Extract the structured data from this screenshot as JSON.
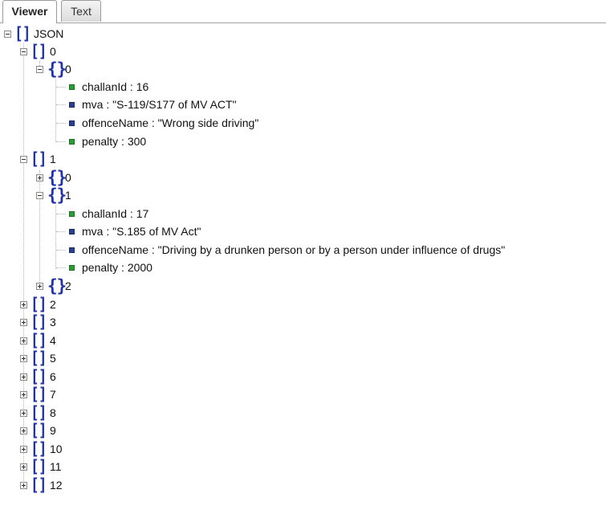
{
  "tabs": [
    {
      "label": "Viewer",
      "active": true
    },
    {
      "label": "Text",
      "active": false
    }
  ],
  "tree": {
    "root_label": "JSON",
    "n0": {
      "label": "0",
      "n0_0": {
        "label": "0",
        "props": [
          {
            "text": "challanId : 16",
            "kind": "number"
          },
          {
            "text": "mva : \"S-119/S177 of MV ACT\"",
            "kind": "string"
          },
          {
            "text": "offenceName : \"Wrong side driving\"",
            "kind": "string"
          },
          {
            "text": "penalty : 300",
            "kind": "number"
          }
        ]
      }
    },
    "n1": {
      "label": "1",
      "n1_0": {
        "label": "0"
      },
      "n1_1": {
        "label": "1",
        "props": [
          {
            "text": "challanId : 17",
            "kind": "number"
          },
          {
            "text": "mva : \"S.185 of MV Act\"",
            "kind": "string"
          },
          {
            "text": "offenceName : \"Driving by a drunken person or by a person under influence of drugs\"",
            "kind": "string"
          },
          {
            "text": "penalty : 2000",
            "kind": "number"
          }
        ]
      },
      "n1_2": {
        "label": "2"
      }
    },
    "collapsed": [
      "2",
      "3",
      "4",
      "5",
      "6",
      "7",
      "8",
      "9",
      "10",
      "11",
      "12"
    ]
  },
  "colors": {
    "bracket": "#2233aa",
    "number_leaf": "#2e9a3a",
    "string_leaf": "#2c3f8f"
  },
  "icons": {
    "expanded": "minus-box-icon",
    "collapsed": "plus-box-icon",
    "array": "array-bracket-icon",
    "object": "object-brace-icon"
  }
}
